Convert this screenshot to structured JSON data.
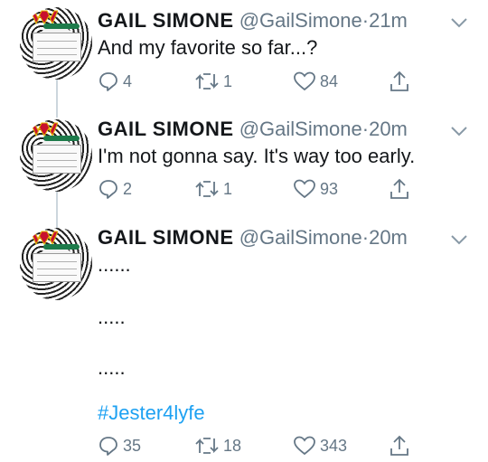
{
  "tweets": [
    {
      "name": "GAIL SIMONE",
      "handle": "@GailSimone",
      "separator": "·",
      "time": "21m",
      "lines": [
        "And my favorite so far...?"
      ],
      "replies": "4",
      "retweets": "1",
      "likes": "84"
    },
    {
      "name": "GAIL SIMONE",
      "handle": "@GailSimone",
      "separator": "·",
      "time": "20m",
      "lines": [
        "I'm not gonna say. It's way too early."
      ],
      "replies": "2",
      "retweets": "1",
      "likes": "93"
    },
    {
      "name": "GAIL SIMONE",
      "handle": "@GailSimone",
      "separator": "·",
      "time": "20m",
      "lines": [
        "......",
        ".....",
        "....."
      ],
      "hashtag": "#Jester4lyfe",
      "replies": "35",
      "retweets": "18",
      "likes": "343"
    }
  ],
  "icons": {
    "avatar_text": "day 1 orientation",
    "reply": "reply-icon",
    "retweet": "retweet-icon",
    "like": "heart-icon",
    "share": "share-icon",
    "caret": "chevron-down-icon"
  },
  "colors": {
    "text": "#14171a",
    "secondary": "#657786",
    "link": "#1da1f2",
    "thread_line": "#ccd6dd"
  }
}
